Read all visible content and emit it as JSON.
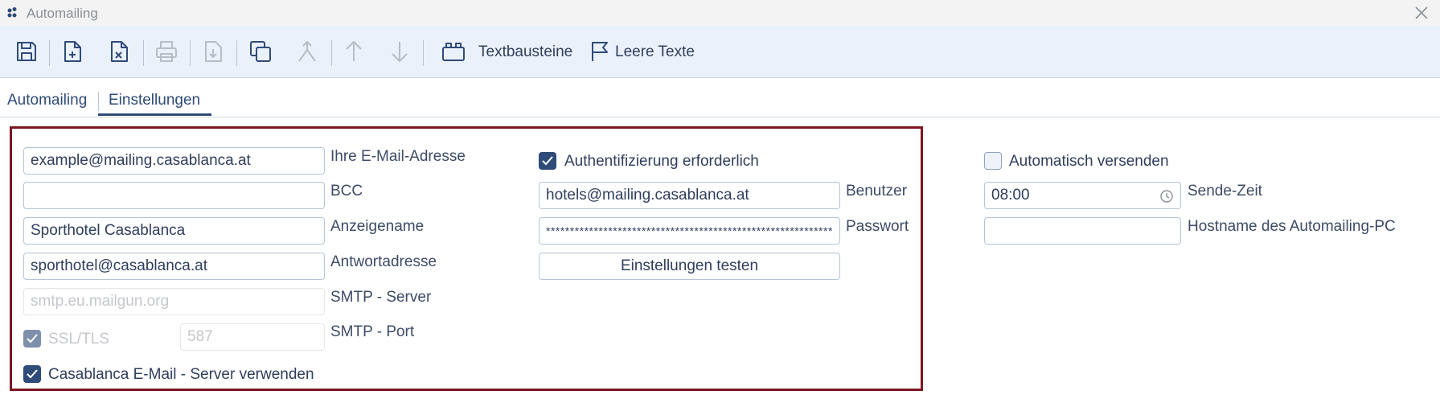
{
  "window": {
    "title": "Automailing"
  },
  "toolbar": {
    "textbausteine_label": "Textbausteine",
    "leere_texte_label": "Leere Texte"
  },
  "tabs": [
    {
      "label": "Automailing",
      "active": false
    },
    {
      "label": "Einstellungen",
      "active": true
    }
  ],
  "mail": {
    "email_value": "example@mailing.casablanca.at",
    "email_label": "Ihre E-Mail-Adresse",
    "bcc_value": "",
    "bcc_label": "BCC",
    "display_name_value": "Sporthotel Casablanca",
    "display_name_label": "Anzeigename",
    "reply_value": "sporthotel@casablanca.at",
    "reply_label": "Antwortadresse",
    "smtp_server_placeholder": "smtp.eu.mailgun.org",
    "smtp_server_label": "SMTP - Server",
    "ssl_label": "SSL/TLS",
    "ssl_checked": true,
    "smtp_port_placeholder": "587",
    "smtp_port_label": "SMTP - Port",
    "use_casablanca_label": "Casablanca E-Mail - Server verwenden",
    "use_casablanca_checked": true
  },
  "auth": {
    "required_label": "Authentifizierung erforderlich",
    "required_checked": true,
    "user_value": "hotels@mailing.casablanca.at",
    "user_label": "Benutzer",
    "password_value": "************************************************************",
    "password_label": "Passwort",
    "test_button_label": "Einstellungen testen"
  },
  "auto_send": {
    "label": "Automatisch versenden",
    "checked": false,
    "time_value": "08:00",
    "time_label": "Sende-Zeit",
    "hostname_value": "",
    "hostname_label": "Hostname des Automailing-PC"
  },
  "colors": {
    "accent": "#2f4b78",
    "panel_border": "#7d1621",
    "toolbar_bg": "#ebf1fb"
  }
}
